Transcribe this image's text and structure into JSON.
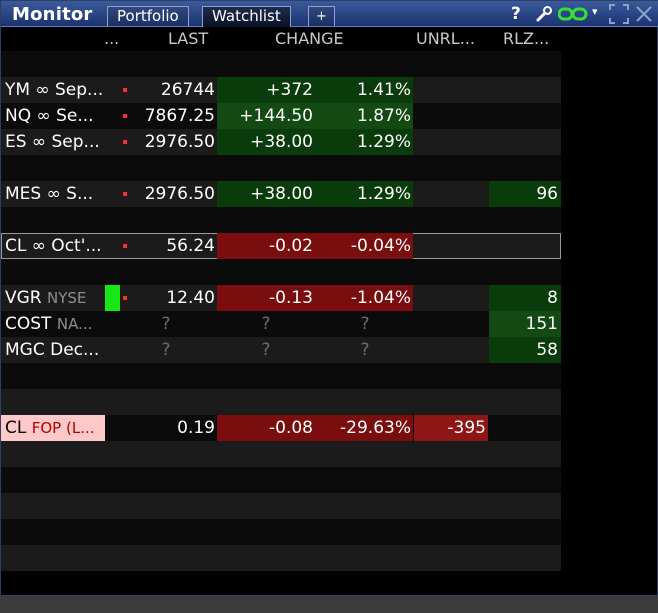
{
  "window": {
    "title": "Monitor",
    "tabs": [
      {
        "label": "Portfolio",
        "active": false
      },
      {
        "label": "Watchlist",
        "active": true
      },
      {
        "label": "+",
        "active": false
      }
    ],
    "icons": [
      "help-icon",
      "wrench-icon",
      "link-icon",
      "dropdown-caret-icon",
      "expand-icon",
      "close-icon"
    ],
    "help_label": "?",
    "caret": "▾"
  },
  "columns": {
    "symbol": "...",
    "last": "LAST",
    "change": "CHANGE",
    "unrealized": "UNRL...",
    "realized": "RLZ..."
  },
  "rows": [
    {
      "symbol": "",
      "exchange": "",
      "last": "",
      "change": "",
      "change_pct": "",
      "unrl": "",
      "rlz": ""
    },
    {
      "symbol": "YM ∞ Sep...",
      "exchange": "",
      "last": "26744",
      "change": "+372",
      "change_pct": "1.41%",
      "unrl": "",
      "rlz": "",
      "dot": true
    },
    {
      "symbol": "NQ ∞ Se...",
      "exchange": "",
      "last": "7867.25",
      "change": "+144.50",
      "change_pct": "1.87%",
      "unrl": "",
      "rlz": "",
      "dot": true
    },
    {
      "symbol": "ES ∞ Sep...",
      "exchange": "",
      "last": "2976.50",
      "change": "+38.00",
      "change_pct": "1.29%",
      "unrl": "",
      "rlz": "",
      "dot": true
    },
    {
      "symbol": "",
      "exchange": "",
      "last": "",
      "change": "",
      "change_pct": "",
      "unrl": "",
      "rlz": ""
    },
    {
      "symbol": "MES ∞ S...",
      "exchange": "",
      "last": "2976.50",
      "change": "+38.00",
      "change_pct": "1.29%",
      "unrl": "",
      "rlz": "96",
      "dot": true
    },
    {
      "symbol": "",
      "exchange": "",
      "last": "",
      "change": "",
      "change_pct": "",
      "unrl": "",
      "rlz": ""
    },
    {
      "symbol": "CL ∞ Oct'...",
      "exchange": "",
      "last": "56.24",
      "change": "-0.02",
      "change_pct": "-0.04%",
      "unrl": "",
      "rlz": "",
      "dot": true,
      "selected": true
    },
    {
      "symbol": "",
      "exchange": "",
      "last": "",
      "change": "",
      "change_pct": "",
      "unrl": "",
      "rlz": ""
    },
    {
      "symbol": "VGR",
      "exchange": "NYSE",
      "last": "12.40",
      "change": "-0.13",
      "change_pct": "-1.04%",
      "unrl": "",
      "rlz": "8",
      "dot": true
    },
    {
      "symbol": "COST",
      "exchange": "NA...",
      "last": "?",
      "change": "?",
      "change_pct": "?",
      "unrl": "",
      "rlz": "151"
    },
    {
      "symbol": "MGC Dec...",
      "exchange": "",
      "last": "?",
      "change": "?",
      "change_pct": "?",
      "unrl": "",
      "rlz": "58"
    },
    {
      "symbol": "",
      "exchange": "",
      "last": "",
      "change": "",
      "change_pct": "",
      "unrl": "",
      "rlz": ""
    },
    {
      "symbol": "",
      "exchange": "",
      "last": "",
      "change": "",
      "change_pct": "",
      "unrl": "",
      "rlz": ""
    },
    {
      "symbol": "CL",
      "exchange": "FOP (L...",
      "last": "0.19",
      "change": "-0.08",
      "change_pct": "-29.63%",
      "unrl": "-395",
      "rlz": ""
    },
    {
      "symbol": "",
      "exchange": "",
      "last": "",
      "change": "",
      "change_pct": "",
      "unrl": "",
      "rlz": ""
    },
    {
      "symbol": "",
      "exchange": "",
      "last": "",
      "change": "",
      "change_pct": "",
      "unrl": "",
      "rlz": ""
    },
    {
      "symbol": "",
      "exchange": "",
      "last": "",
      "change": "",
      "change_pct": "",
      "unrl": "",
      "rlz": ""
    },
    {
      "symbol": "",
      "exchange": "",
      "last": "",
      "change": "",
      "change_pct": "",
      "unrl": "",
      "rlz": ""
    },
    {
      "symbol": "",
      "exchange": "",
      "last": "",
      "change": "",
      "change_pct": "",
      "unrl": "",
      "rlz": ""
    }
  ],
  "colors": {
    "positive": "#0a3b0a",
    "negative": "#7a0e0e",
    "highlight_symbol": "#ffc9c9",
    "bar_green": "#17e617",
    "titlebar": "#1c3370"
  }
}
